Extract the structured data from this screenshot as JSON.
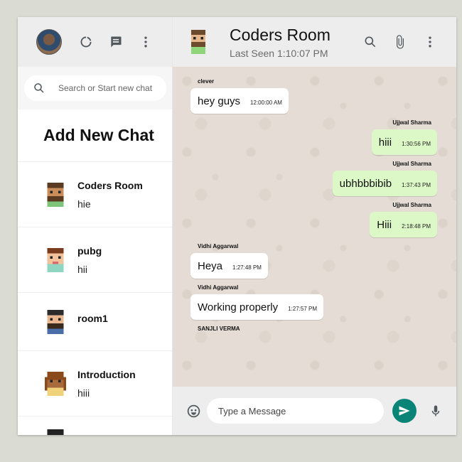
{
  "colors": {
    "accent": "#0a8477",
    "sent_bubble": "#dcf8c6",
    "received_bubble": "#ffffff",
    "chat_bg": "#e5ddd5"
  },
  "sidebar": {
    "icons": [
      "status-icon",
      "new-chat-icon",
      "menu-icon"
    ],
    "search": {
      "placeholder": "Search or Start new chat",
      "value": ""
    },
    "add_new_chat": "Add New Chat",
    "chats": [
      {
        "name": "Coders Room",
        "last": "hie"
      },
      {
        "name": "pubg",
        "last": "hii"
      },
      {
        "name": "room1",
        "last": ""
      },
      {
        "name": "Introduction",
        "last": "hiii"
      }
    ]
  },
  "header": {
    "room_name": "Coders Room",
    "last_seen": "Last Seen 1:10:07 PM",
    "icons": [
      "search-icon",
      "attach-icon",
      "menu-icon"
    ]
  },
  "messages": [
    {
      "sender": "clever",
      "text": "hey guys",
      "time": "12:00:00 AM",
      "sent": false
    },
    {
      "sender": "Ujjwal Sharma",
      "text": "hiii",
      "time": "1:30:56 PM",
      "sent": true
    },
    {
      "sender": "Ujjwal Sharma",
      "text": "ubhbbbibib",
      "time": "1:37:43 PM",
      "sent": true
    },
    {
      "sender": "Ujjwal Sharma",
      "text": "Hiii",
      "time": "2:18:48 PM",
      "sent": true
    },
    {
      "sender": "Vidhi Aggarwal",
      "text": "Heya",
      "time": "1:27:48 PM",
      "sent": false
    },
    {
      "sender": "Vidhi Aggarwal",
      "text": "Working properly",
      "time": "1:27:57 PM",
      "sent": false
    },
    {
      "sender": "SANJLI VERMA",
      "text": "",
      "time": "",
      "sent": false
    }
  ],
  "footer": {
    "input_placeholder": "Type a Message",
    "input_value": "",
    "icons": [
      "emoji-icon",
      "send-icon",
      "mic-icon"
    ]
  }
}
